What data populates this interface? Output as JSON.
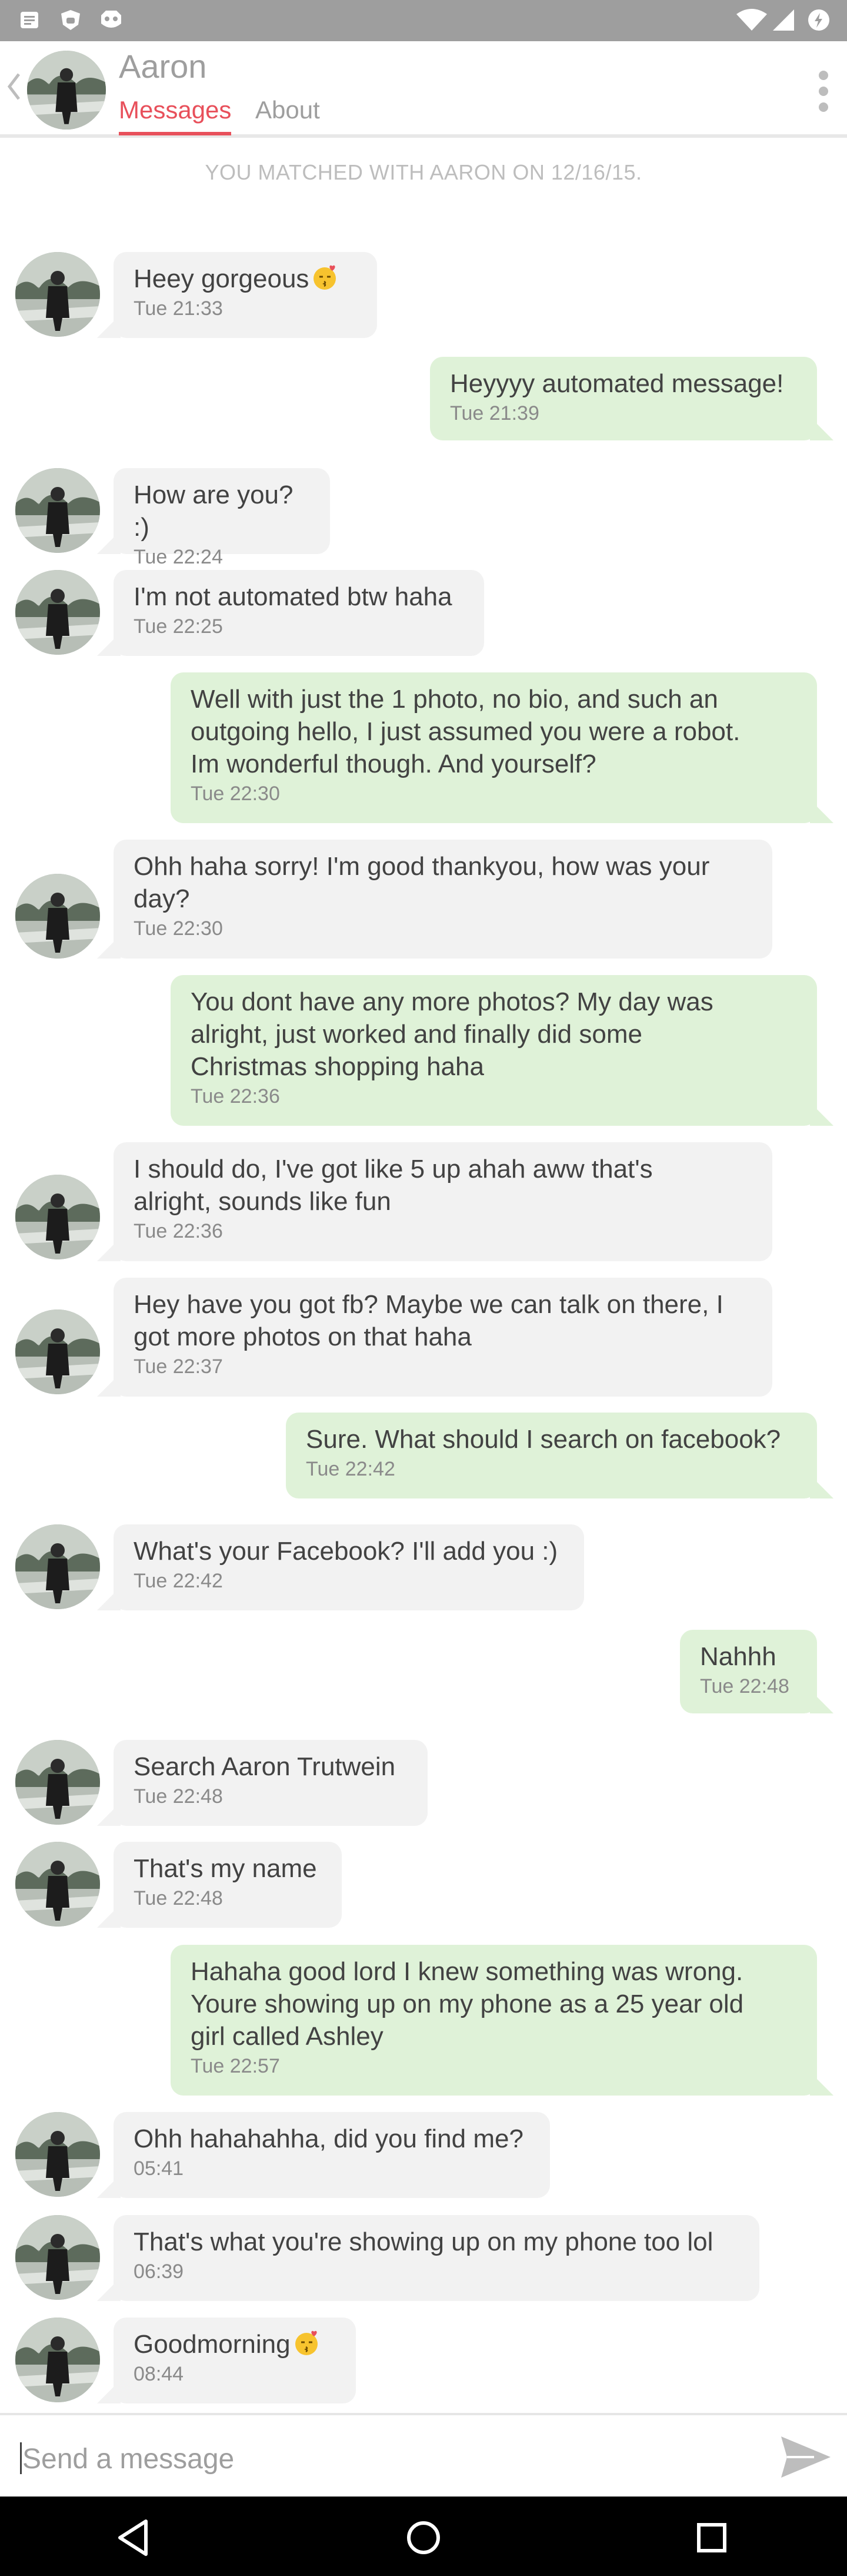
{
  "status_bar": {
    "left_icons": [
      "notes-icon",
      "debug-icon",
      "android-icon"
    ],
    "right_icons": [
      "wifi-icon",
      "signal-icon",
      "battery-icon"
    ]
  },
  "header": {
    "name": "Aaron",
    "tabs": [
      {
        "label": "Messages",
        "active": true
      },
      {
        "label": "About",
        "active": false
      }
    ],
    "accent_color": "#e8505b"
  },
  "match_note": "YOU MATCHED WITH AARON ON 12/16/15.",
  "messages": [
    {
      "side": "in",
      "lines": [
        "Heey gorgeous"
      ],
      "emoji": "kiss-emoji",
      "time": "Tue 21:33"
    },
    {
      "side": "out",
      "lines": [
        "Heyyyy automated message!"
      ],
      "time": "Tue 21:39"
    },
    {
      "side": "in",
      "lines": [
        "How are you? :)"
      ],
      "time": "Tue 22:24"
    },
    {
      "side": "in",
      "lines": [
        "I'm not automated btw haha"
      ],
      "time": "Tue 22:25"
    },
    {
      "side": "out",
      "lines": [
        "Well with just the 1 photo, no bio, and such an",
        "outgoing hello, I just assumed you were a robot.",
        "Im wonderful though. And yourself?"
      ],
      "time": "Tue 22:30"
    },
    {
      "side": "in",
      "lines": [
        "Ohh haha sorry! I'm good thankyou, how was your",
        "day?"
      ],
      "time": "Tue 22:30"
    },
    {
      "side": "out",
      "lines": [
        "You dont have any more photos? My day was",
        "alright, just worked and finally did some",
        "Christmas shopping haha"
      ],
      "time": "Tue 22:36"
    },
    {
      "side": "in",
      "lines": [
        "I should do, I've got like 5 up ahah aww that's",
        "alright, sounds like fun"
      ],
      "time": "Tue 22:36"
    },
    {
      "side": "in",
      "lines": [
        "Hey have you got fb? Maybe we can talk on there, I",
        "got more photos on that haha"
      ],
      "time": "Tue 22:37"
    },
    {
      "side": "out",
      "lines": [
        "Sure. What should I search on facebook?"
      ],
      "time": "Tue 22:42"
    },
    {
      "side": "in",
      "lines": [
        "What's your Facebook? I'll add you :)"
      ],
      "time": "Tue 22:42"
    },
    {
      "side": "out",
      "lines": [
        "Nahhh"
      ],
      "time": "Tue 22:48"
    },
    {
      "side": "in",
      "lines": [
        "Search Aaron Trutwein"
      ],
      "time": "Tue 22:48"
    },
    {
      "side": "in",
      "lines": [
        "That's my name"
      ],
      "time": "Tue 22:48"
    },
    {
      "side": "out",
      "lines": [
        "Hahaha good lord I knew something was wrong.",
        "Youre showing up on my phone as a 25 year old",
        "girl called Ashley"
      ],
      "time": "Tue 22:57"
    },
    {
      "side": "in",
      "lines": [
        "Ohh hahahahha, did you find me?"
      ],
      "time": "05:41"
    },
    {
      "side": "in",
      "lines": [
        "That's what you're showing up on my phone too lol"
      ],
      "time": "06:39"
    },
    {
      "side": "in",
      "lines": [
        "Goodmorning"
      ],
      "emoji": "kiss-emoji",
      "time": "08:44"
    }
  ],
  "composer": {
    "placeholder": "Send a message",
    "send_icon": "send-icon"
  },
  "nav_bar": [
    "back-triangle-icon",
    "home-circle-icon",
    "recents-square-icon"
  ],
  "colors": {
    "incoming_bubble": "#f2f2f2",
    "outgoing_bubble": "#dff2d8",
    "timestamp": "#8a8a8a"
  }
}
